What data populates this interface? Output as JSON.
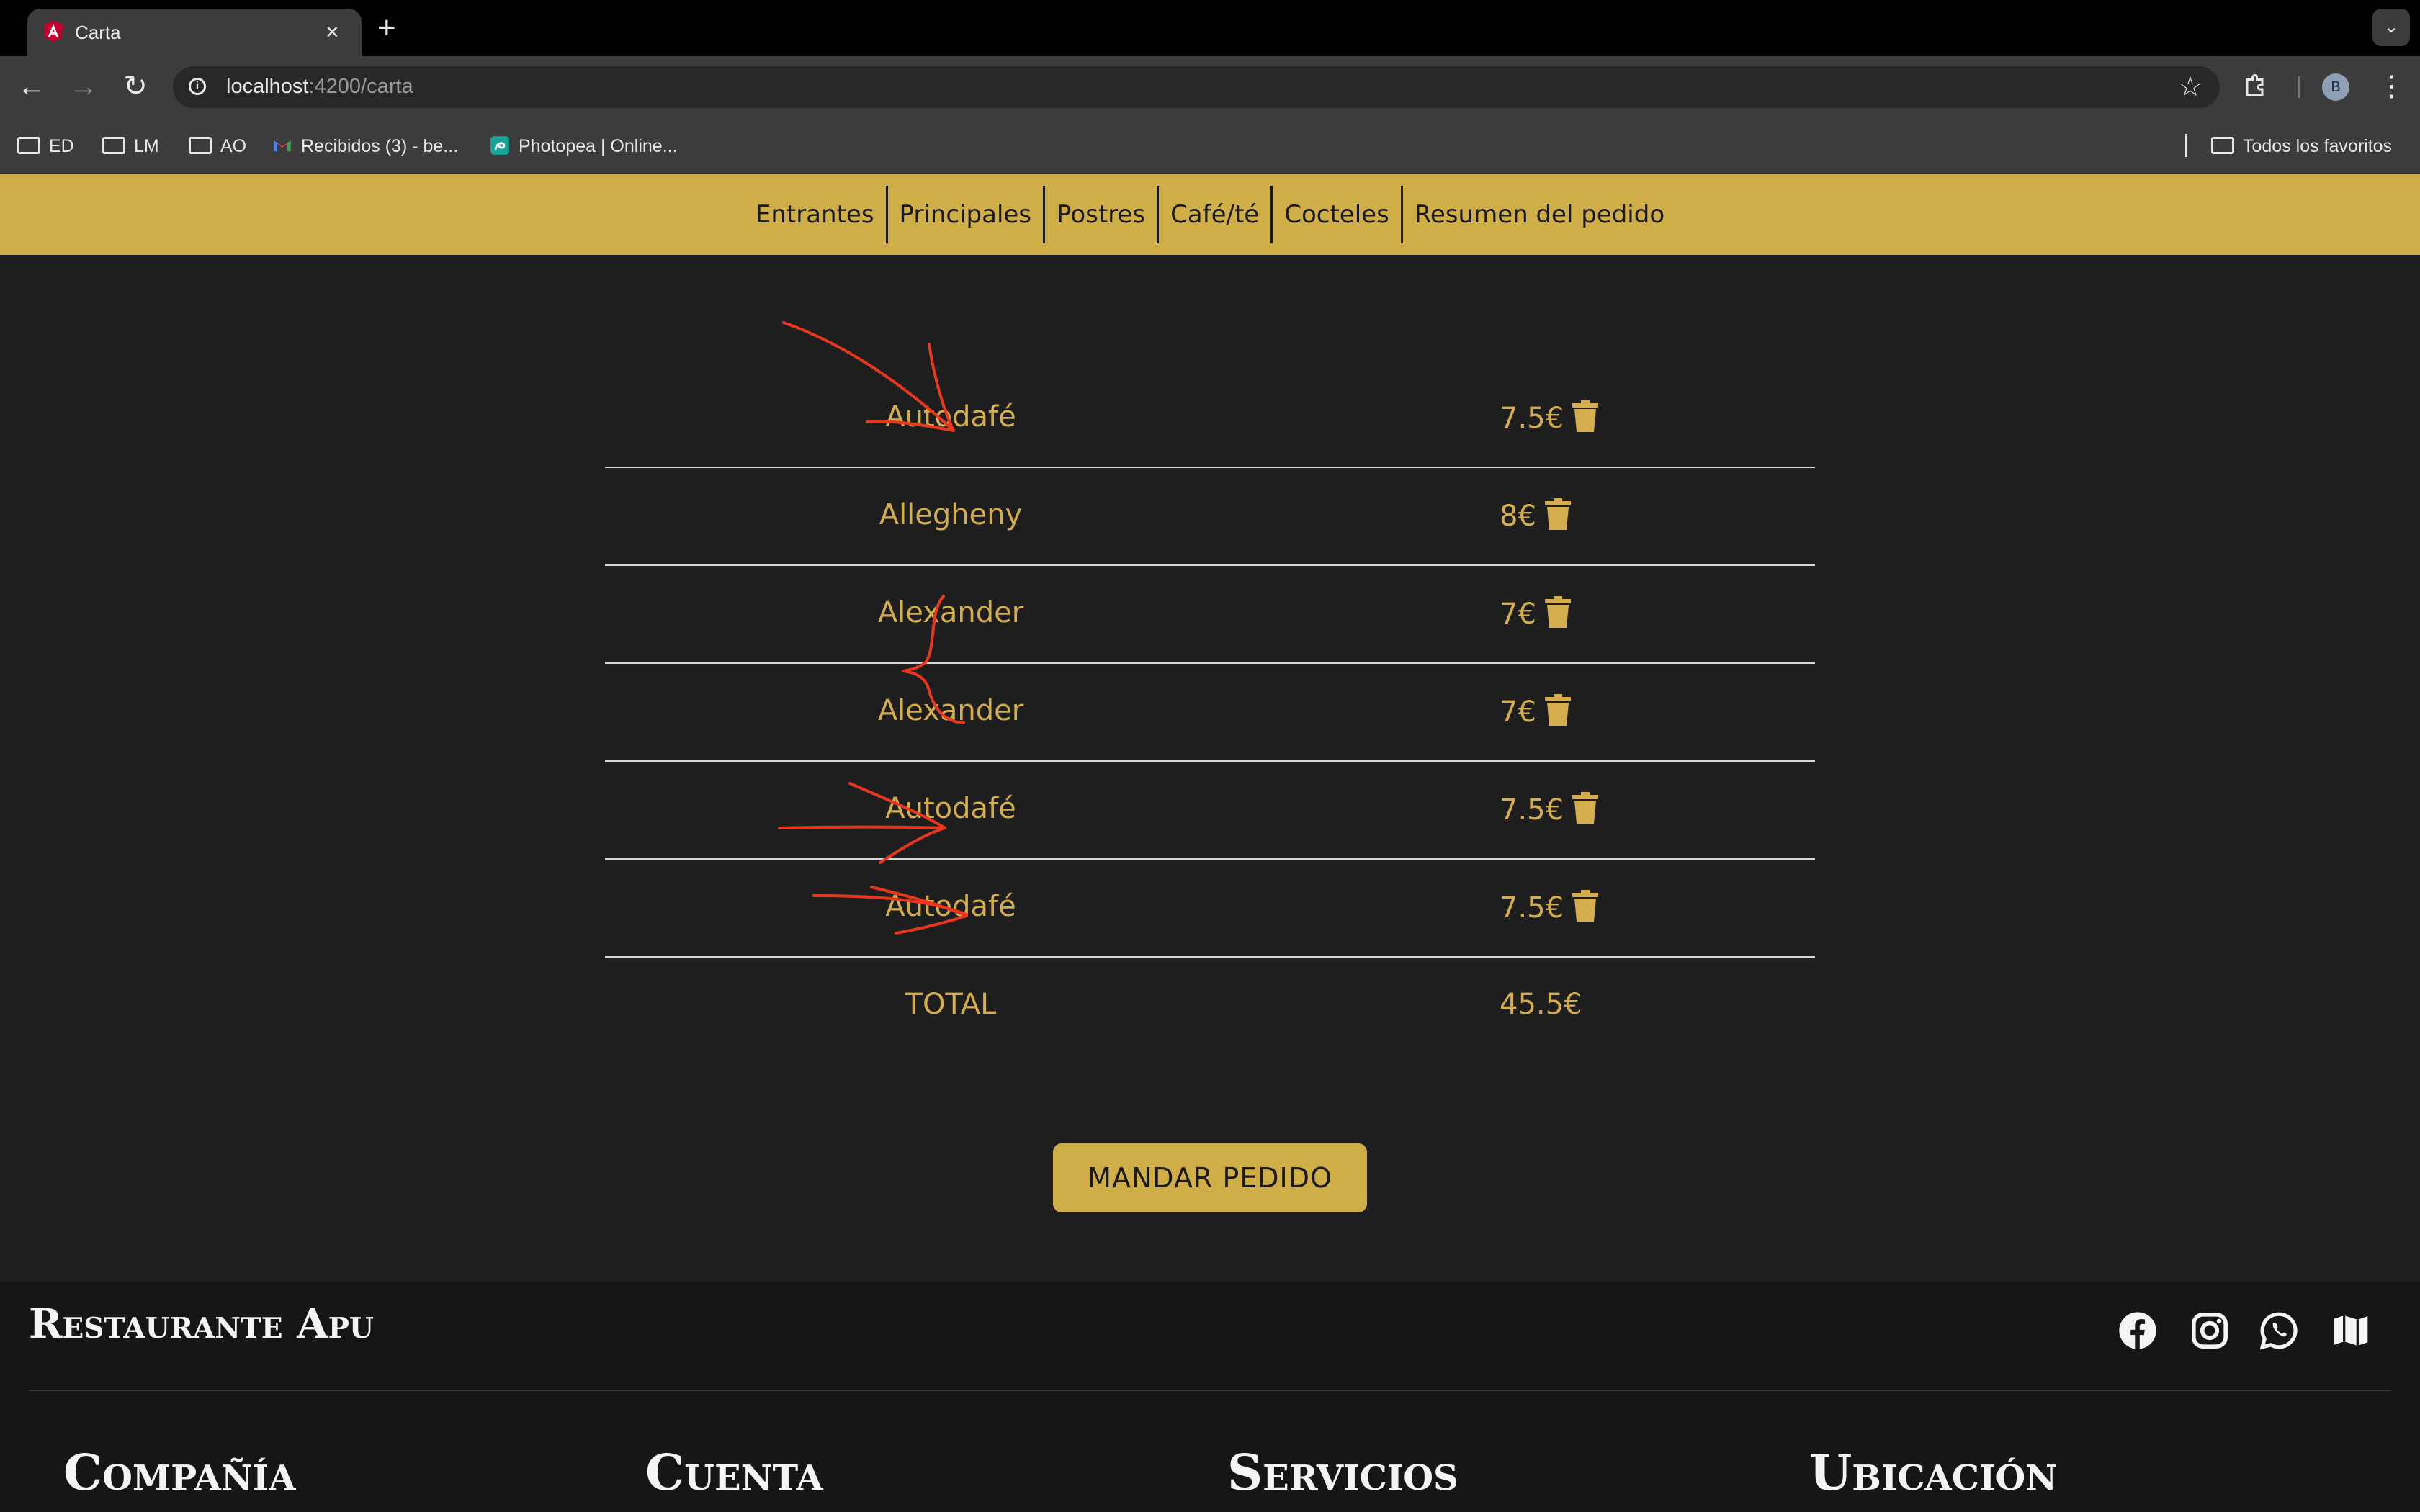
{
  "browser": {
    "tab_title": "Carta",
    "tab_close": "×",
    "new_tab": "+",
    "url_host": "localhost",
    "url_path": ":4200/carta",
    "profile_initial": "B",
    "bookmarks": [
      "ED",
      "LM",
      "AO",
      "Recibidos (3) - be...",
      "Photopea | Online..."
    ],
    "all_bookmarks": "Todos los favoritos"
  },
  "nav": {
    "items": [
      "Entrantes",
      "Principales",
      "Postres",
      "Café/té",
      "Cocteles",
      "Resumen del pedido"
    ]
  },
  "order": {
    "items": [
      {
        "name": "Autodafé",
        "price": "7.5€"
      },
      {
        "name": "Allegheny",
        "price": "8€"
      },
      {
        "name": "Alexander",
        "price": "7€"
      },
      {
        "name": "Alexander",
        "price": "7€"
      },
      {
        "name": "Autodafé",
        "price": "7.5€"
      },
      {
        "name": "Autodafé",
        "price": "7.5€"
      }
    ],
    "total_label": "TOTAL",
    "total_value": "45.5€",
    "send_button": "MANDAR PEDIDO"
  },
  "footer": {
    "brand": "Restaurante Apu",
    "columns": [
      "Compañía",
      "Cuenta",
      "Servicios",
      "Ubicación"
    ],
    "social_icons": [
      "facebook-icon",
      "instagram-icon",
      "whatsapp-icon",
      "map-icon"
    ]
  },
  "colors": {
    "accent": "#cfae48",
    "text_gold": "#d4ae4e",
    "background": "#1e1e1e",
    "annotation": "#e8371f"
  }
}
